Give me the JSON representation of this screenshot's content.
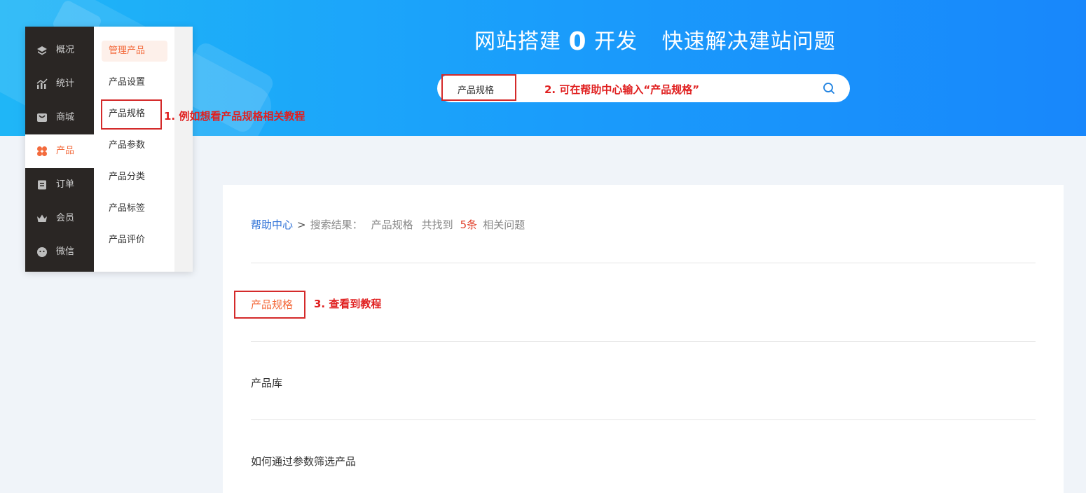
{
  "banner": {
    "headline_a": "网站搭建",
    "headline_zero": "0",
    "headline_b": "开发",
    "headline_c": "快速解决建站问题"
  },
  "search": {
    "value": "产品规格"
  },
  "annotations": {
    "step1": "1. 例如想看产品规格相关教程",
    "step2": "2. 可在帮助中心输入“产品规格”",
    "step3": "3. 查看到教程"
  },
  "sidebar": {
    "nav": [
      {
        "label": "概况",
        "icon": "layers-icon"
      },
      {
        "label": "统计",
        "icon": "chart-icon"
      },
      {
        "label": "商城",
        "icon": "shop-icon"
      },
      {
        "label": "产品",
        "icon": "product-icon"
      },
      {
        "label": "订单",
        "icon": "order-icon"
      },
      {
        "label": "会员",
        "icon": "crown-icon"
      },
      {
        "label": "微信",
        "icon": "wechat-icon"
      }
    ],
    "active_nav": "产品",
    "submenu": [
      "管理产品",
      "产品设置",
      "产品规格",
      "产品参数",
      "产品分类",
      "产品标签",
      "产品评价"
    ],
    "active_sub": "管理产品"
  },
  "breadcrumb": {
    "home": "帮助中心",
    "separator": ">",
    "prefix": "搜索结果：",
    "keyword": "产品规格",
    "found_label": "共找到",
    "count": "5条",
    "suffix": "相关问题"
  },
  "results": [
    "产品规格",
    "产品库",
    "如何通过参数筛选产品"
  ],
  "colors": {
    "accent": "#f36b3d",
    "annotation": "#e02020",
    "link": "#2b6fd6",
    "banner_start": "#1fb6f7",
    "banner_end": "#1887fb",
    "sidebar_dark": "#2a2624"
  }
}
